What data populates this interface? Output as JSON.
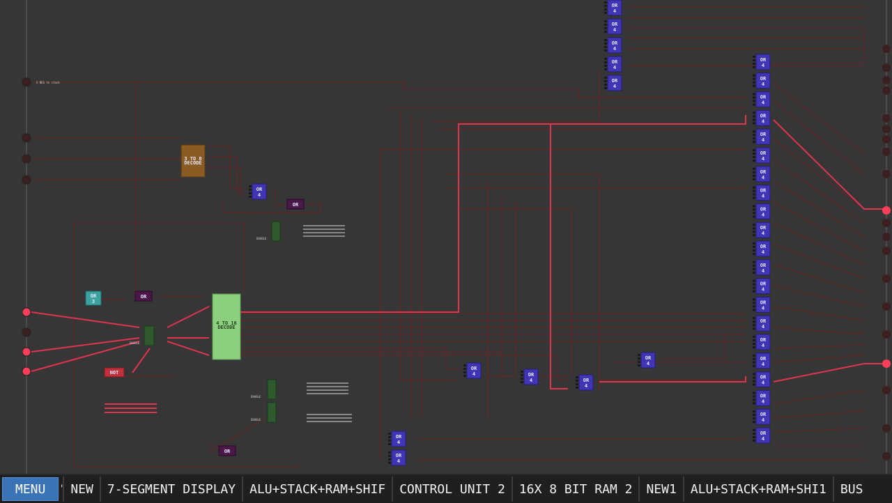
{
  "tabbar": {
    "menu_label": "MENU",
    "tabs": [
      {
        "label": "NEW"
      },
      {
        "label": "7-SEGMENT DISPLAY"
      },
      {
        "label": "ALU+STACK+RAM+SHIF"
      },
      {
        "label": "CONTROL UNIT 2"
      },
      {
        "label": "16X 8 BIT RAM 2"
      },
      {
        "label": "NEW1"
      },
      {
        "label": "ALU+STACK+RAM+SHI1"
      },
      {
        "label": "BUS"
      }
    ]
  },
  "circuit": {
    "decoder_3to8": {
      "title_line1": "3 TO 8",
      "title_line2": "DECODE"
    },
    "decoder_4to16": {
      "title_line1": "4 TO 16",
      "title_line2": "DECODE"
    },
    "or4_label": "OR",
    "or4_count": "4",
    "or_label": "OR",
    "or3_label": "OR",
    "or3_count": "3",
    "not_label": "NOT",
    "enable_label": "ENABLE",
    "input_top_label": "X NEG to stack"
  },
  "colors": {
    "wire_off": "#5a2a2a",
    "wire_on": "#e0344f",
    "or_gate": "#3f35b5",
    "or2_gate": "#4a1748",
    "or3_gate": "#3aa3a0",
    "not_gate": "#c0303a",
    "decoder3": "#8a5c23",
    "decoder4": "#8ccf7f",
    "buffer": "#2f5a2e",
    "pin_on": "#ff3f5a",
    "pin_off": "#3a2020"
  }
}
